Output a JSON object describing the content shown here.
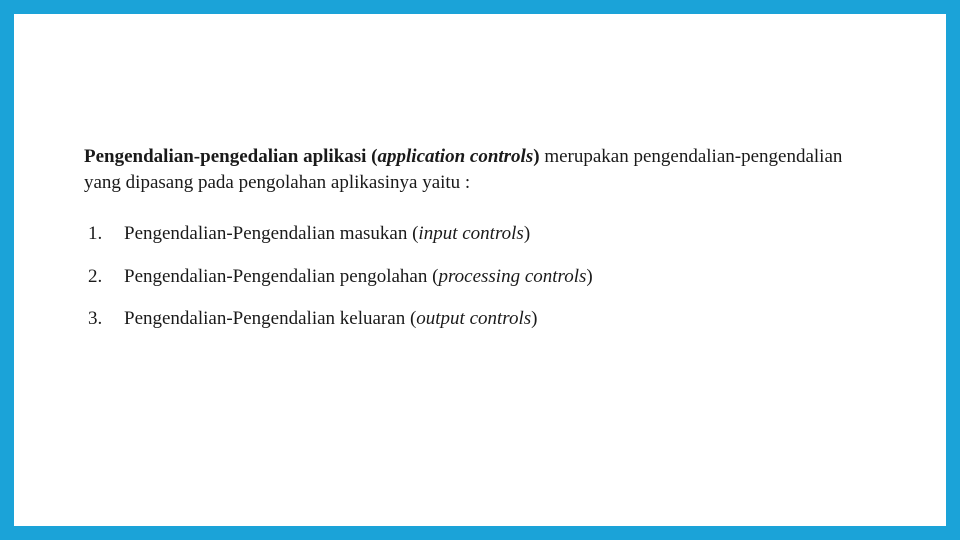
{
  "intro": {
    "bold_prefix": "Pengendalian-pengedalian aplikasi (",
    "italic_term": "application controls",
    "bold_suffix": ") ",
    "rest": "merupakan pengendalian-pengendalian yang dipasang pada pengolahan aplikasinya yaitu :"
  },
  "items": [
    {
      "num": "1.",
      "text_a": "Pengendalian-Pengendalian  masukan (",
      "italic": "input controls",
      "text_b": ")"
    },
    {
      "num": "2.",
      "text_a": "Pengendalian-Pengendalian pengolahan (",
      "italic": "processing controls",
      "text_b": ")"
    },
    {
      "num": "3.",
      "text_a": "Pengendalian-Pengendalian keluaran (",
      "italic": "output controls",
      "text_b": ")"
    }
  ]
}
